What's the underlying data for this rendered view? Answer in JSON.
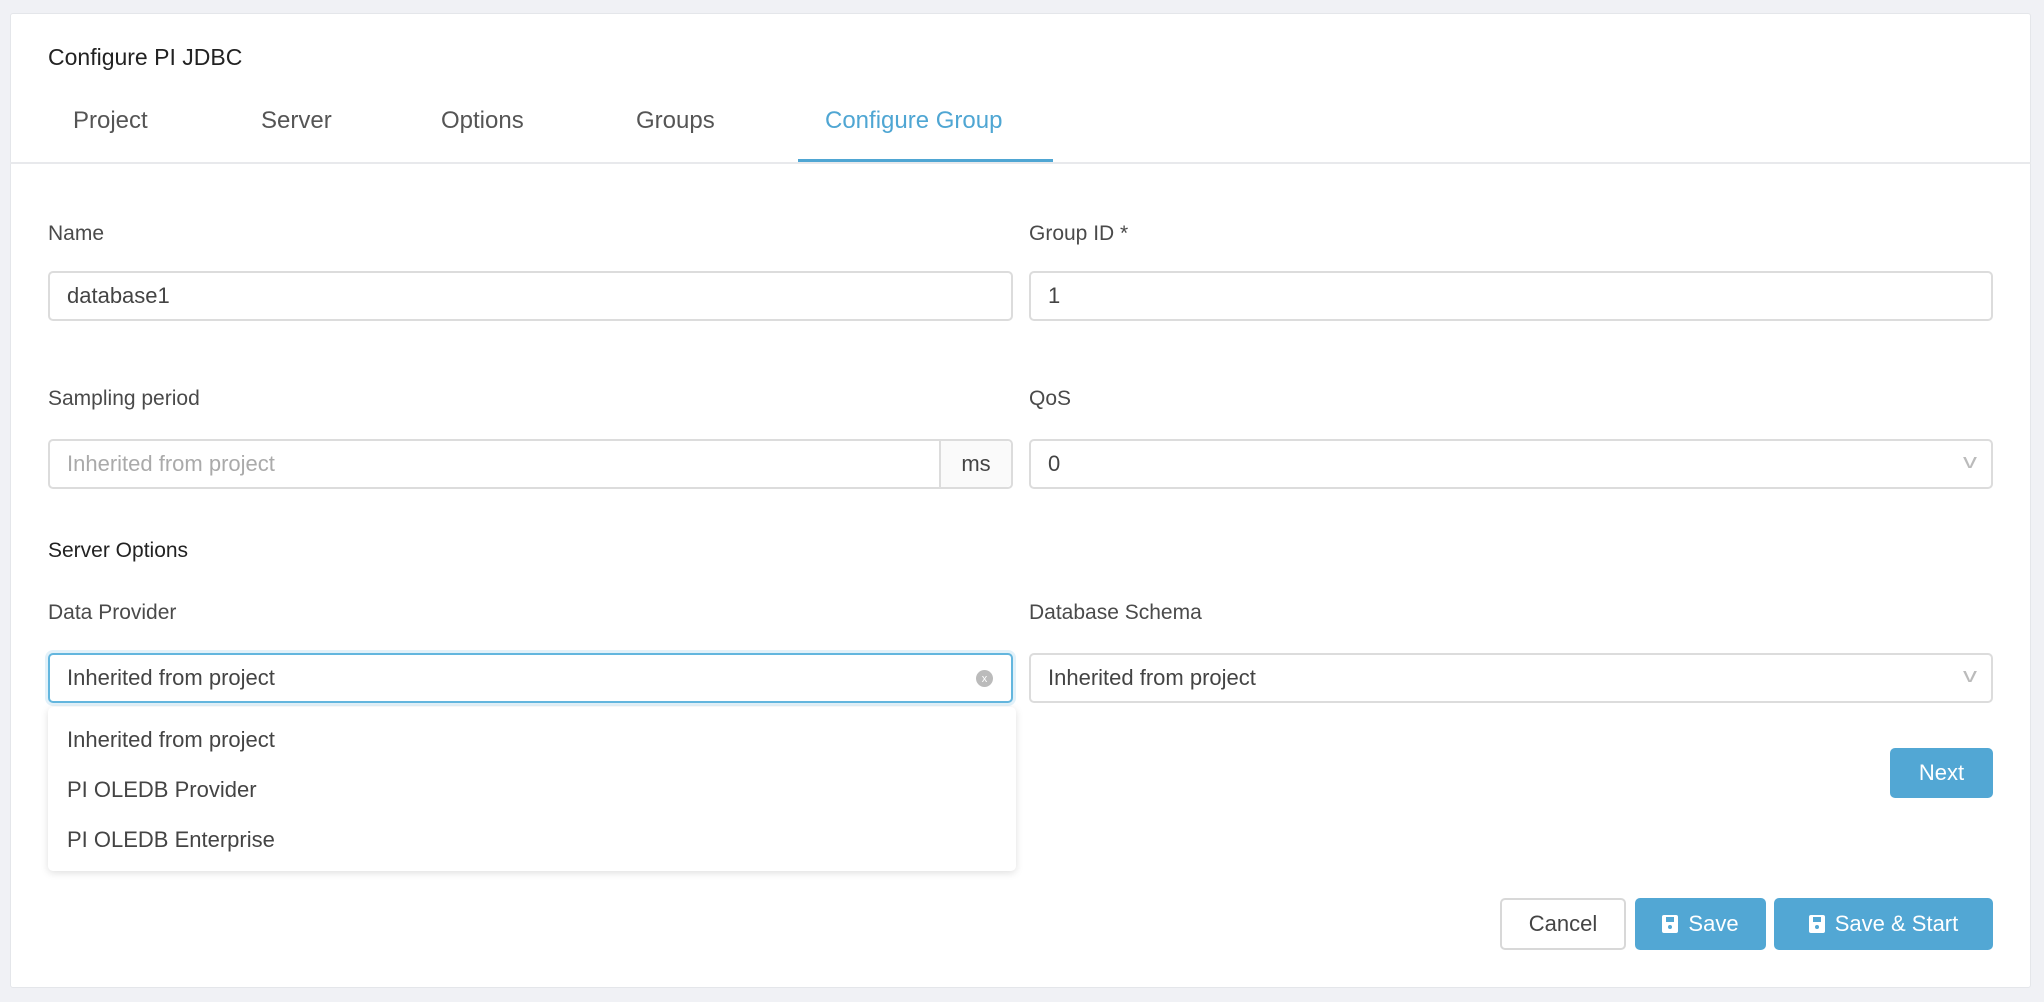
{
  "title": "Configure PI JDBC",
  "tabs": [
    {
      "label": "Project"
    },
    {
      "label": "Server"
    },
    {
      "label": "Options"
    },
    {
      "label": "Groups"
    },
    {
      "label": "Configure Group",
      "active": true
    }
  ],
  "form": {
    "name": {
      "label": "Name",
      "value": "database1"
    },
    "group_id": {
      "label": "Group ID *",
      "value": "1"
    },
    "sampling_period": {
      "label": "Sampling period",
      "placeholder": "Inherited from project",
      "unit": "ms"
    },
    "qos": {
      "label": "QoS",
      "value": "0"
    },
    "server_options_heading": "Server Options",
    "data_provider": {
      "label": "Data Provider",
      "value": "Inherited from project",
      "options": [
        "Inherited from project",
        "PI OLEDB Provider",
        "PI OLEDB Enterprise"
      ]
    },
    "database_schema": {
      "label": "Database Schema",
      "value": "Inherited from project"
    }
  },
  "buttons": {
    "next": "Next",
    "cancel": "Cancel",
    "save": "Save",
    "save_start": "Save & Start"
  },
  "colors": {
    "accent": "#52a7d4",
    "background": "#f0f1f5"
  }
}
